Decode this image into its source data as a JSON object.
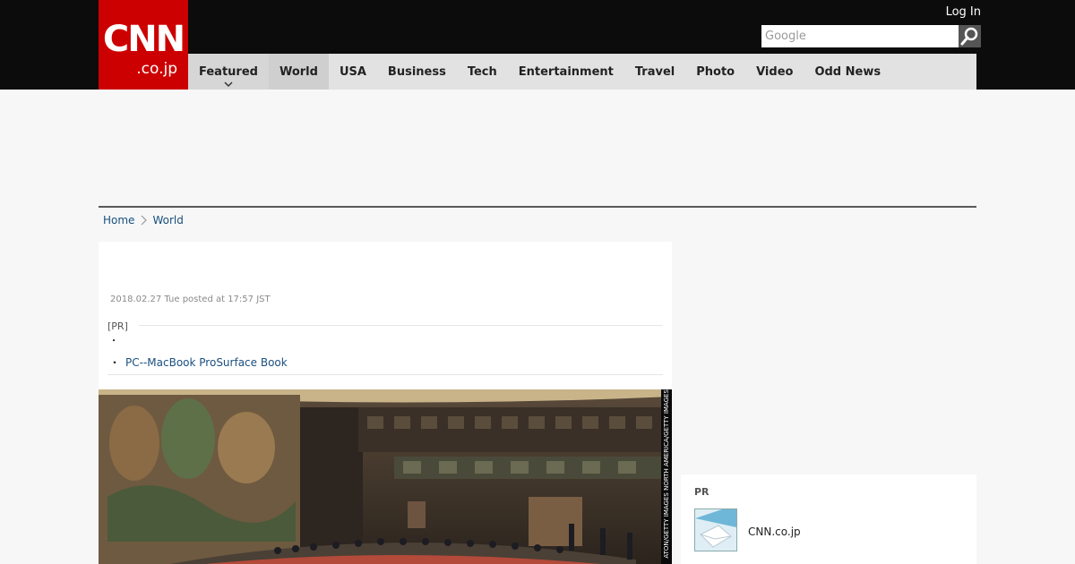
{
  "header": {
    "logo_main": "CNN",
    "logo_sub": ".co.jp",
    "login_label": "Log In",
    "search_placeholder": "Google"
  },
  "nav": {
    "items": [
      {
        "label": "Featured"
      },
      {
        "label": "World"
      },
      {
        "label": "USA"
      },
      {
        "label": "Business"
      },
      {
        "label": "Tech"
      },
      {
        "label": "Entertainment"
      },
      {
        "label": "Travel"
      },
      {
        "label": "Photo"
      },
      {
        "label": "Video"
      },
      {
        "label": "Odd News"
      }
    ]
  },
  "breadcrumb": {
    "home": "Home",
    "current": "World"
  },
  "article": {
    "date": "2018.02.27 Tue posted at 17:57 JST",
    "pr_label": "[PR]",
    "pr_bullet_1": "・",
    "pr_bullet_2": "・",
    "pr_link": "PC--MacBook ProSurface Book",
    "photo_credit": "ATON/GETTY IMAGES NORTH AMERICA/GETTY IMAGES"
  },
  "sidebar": {
    "title": "PR",
    "link": "CNN.co.jp"
  },
  "colors": {
    "brand_red": "#cc0000",
    "header_bg": "#0c0c0c",
    "nav_bg": "#e2e2e2",
    "link_blue": "#1a4f80"
  }
}
